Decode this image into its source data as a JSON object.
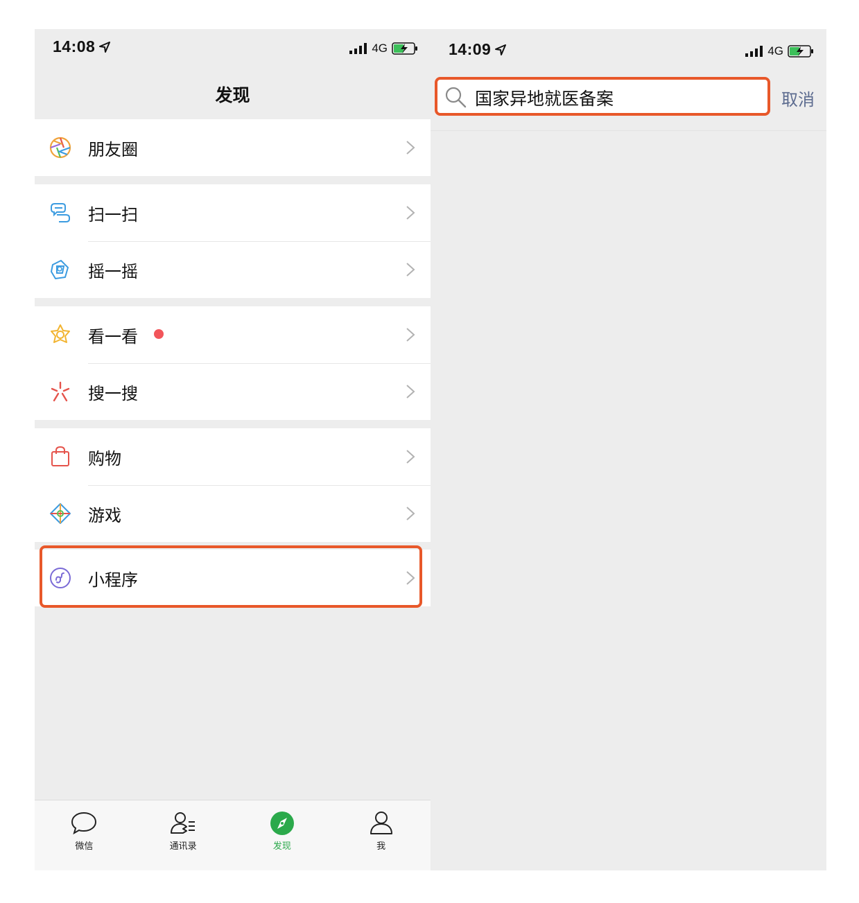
{
  "left": {
    "status": {
      "time": "14:08",
      "network": "4G"
    },
    "nav_title": "发现",
    "groups": [
      {
        "items": [
          {
            "label": "朋友圈"
          }
        ]
      },
      {
        "items": [
          {
            "label": "扫一扫"
          },
          {
            "label": "摇一摇"
          }
        ]
      },
      {
        "items": [
          {
            "label": "看一看"
          },
          {
            "label": "搜一搜"
          }
        ]
      },
      {
        "items": [
          {
            "label": "购物"
          },
          {
            "label": "游戏"
          }
        ]
      },
      {
        "items": [
          {
            "label": "小程序"
          }
        ]
      }
    ],
    "tabbar": [
      {
        "label": "微信",
        "icon": "chat-bubble-icon"
      },
      {
        "label": "通讯录",
        "icon": "contacts-icon"
      },
      {
        "label": "发现",
        "icon": "compass-icon",
        "active": true
      },
      {
        "label": "我",
        "icon": "person-icon"
      }
    ]
  },
  "right": {
    "status": {
      "time": "14:09",
      "network": "4G"
    },
    "search": {
      "query": "国家异地就医备案",
      "icon": "search-icon"
    },
    "cancel_label": "取消"
  },
  "colors": {
    "highlight": "#e8582a",
    "accent_green": "#2ba94b",
    "badge_red": "#f2555a",
    "cancel_blue": "#5c6b8f",
    "page_bg": "#ededed"
  }
}
